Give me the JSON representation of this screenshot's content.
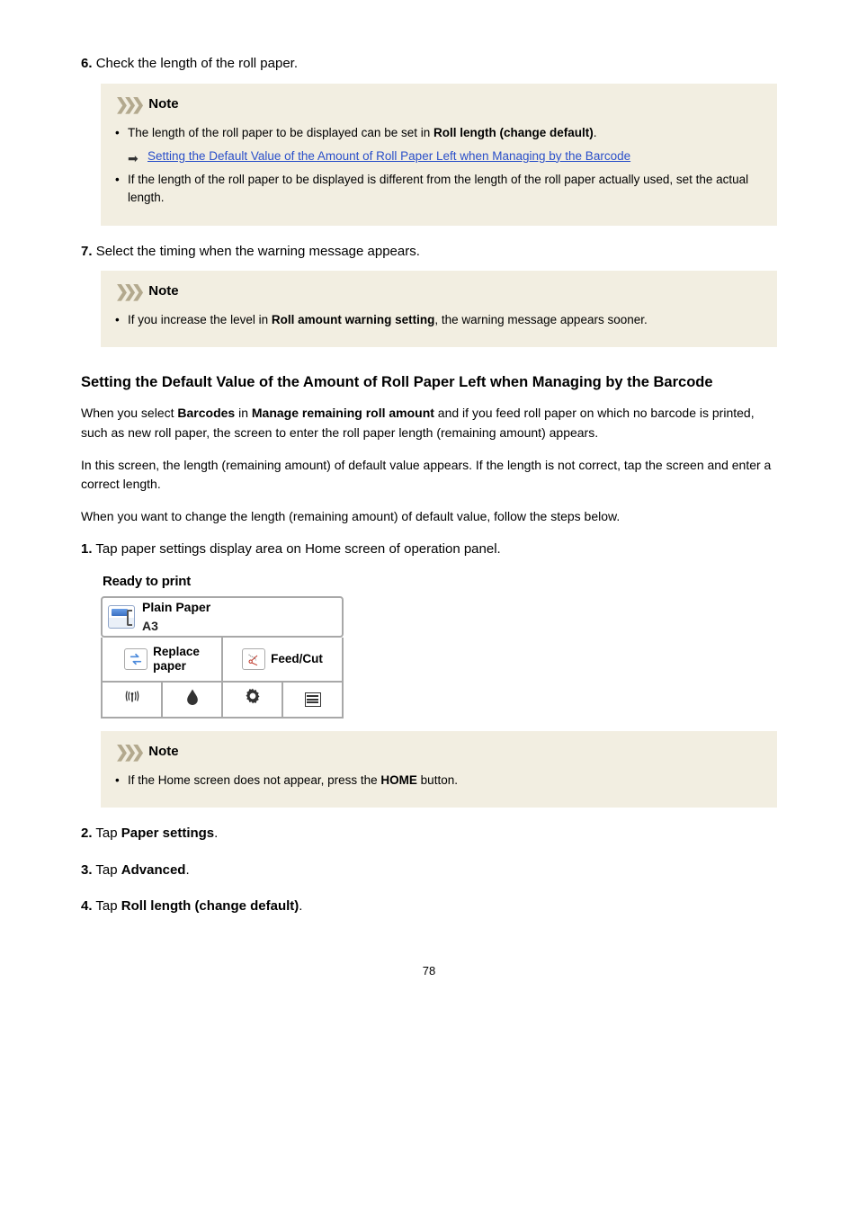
{
  "step6": {
    "num": "6.",
    "text": "Check the length of the roll paper.",
    "note_label": "Note",
    "li1_a": "The length of the roll paper to be displayed can be set in ",
    "li1_b": "Roll length (change default)",
    "li1_c": ".",
    "li1_link": "Setting the Default Value of the Amount of Roll Paper Left when Managing by the Barcode",
    "li2": "If the length of the roll paper to be displayed is different from the length of the roll paper actually used, set the actual length."
  },
  "step7": {
    "num": "7.",
    "text": "Select the timing when the warning message appears.",
    "note_label": "Note",
    "li1_a": "If you increase the level in ",
    "li1_b": "Roll amount warning setting",
    "li1_c": ", the warning message appears sooner."
  },
  "section_heading": "Setting the Default Value of the Amount of Roll Paper Left when Managing by the Barcode",
  "para1_a": "When you select ",
  "para1_b": "Barcodes",
  "para1_c": " in ",
  "para1_d": "Manage remaining roll amount",
  "para1_e": " and if you feed roll paper on which no barcode is printed, such as new roll paper, the screen to enter the roll paper length (remaining amount) appears.",
  "para2": "In this screen, the length (remaining amount) of default value appears. If the length is not correct, tap the screen and enter a correct length.",
  "para3": "When you want to change the length (remaining amount) of default value, follow the steps below.",
  "s1": {
    "num": "1.",
    "text": "Tap paper settings display area on Home screen of operation panel."
  },
  "panel": {
    "ready": "Ready to print",
    "paper_type": "Plain Paper",
    "paper_size": "A3",
    "replace": "Replace paper",
    "feed": "Feed/Cut"
  },
  "s1note": {
    "label": "Note",
    "li_a": "If the Home screen does not appear, press the ",
    "li_b": "HOME",
    "li_c": " button."
  },
  "s2": {
    "num": "2.",
    "a": "Tap ",
    "b": "Paper settings",
    "c": "."
  },
  "s3": {
    "num": "3.",
    "a": "Tap ",
    "b": "Advanced",
    "c": "."
  },
  "s4": {
    "num": "4.",
    "a": "Tap ",
    "b": "Roll length (change default)",
    "c": "."
  },
  "page_number": "78"
}
